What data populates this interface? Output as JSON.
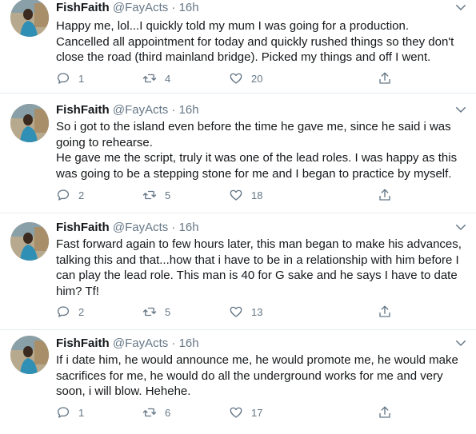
{
  "tweets": [
    {
      "name": "FishFaith",
      "handle": "@FayActs",
      "sep": "·",
      "time": "16h",
      "text": "Happy me, lol...I quickly told my mum I was going for a production.\nCancelled all appointment for today and quickly rushed things so they don't\nclose the road (third mainland bridge). Picked my things and off I went.",
      "replies": "1",
      "retweets": "4",
      "likes": "20"
    },
    {
      "name": "FishFaith",
      "handle": "@FayActs",
      "sep": "·",
      "time": "16h",
      "text": "So i got to the island even before the time he gave me, since he said i was\ngoing to rehearse.\nHe gave me the script, truly it was one of the lead roles. I was happy as this\nwas going to be a stepping stone for me and I began to practice by myself.",
      "replies": "2",
      "retweets": "5",
      "likes": "18"
    },
    {
      "name": "FishFaith",
      "handle": "@FayActs",
      "sep": "·",
      "time": "16h",
      "text": "Fast forward again to few hours later, this man began to make his advances,\ntalking this and that...how that i have to be in a relationship with him before I\ncan play the lead role. This man is 40 for G sake and he says I have to date\nhim? Tf!",
      "replies": "2",
      "retweets": "5",
      "likes": "13"
    },
    {
      "name": "FishFaith",
      "handle": "@FayActs",
      "sep": "·",
      "time": "16h",
      "text": "If i date him, he would announce me, he would promote me, he would make\nsacrifices for me, he would do all the underground works for me and very\nsoon, i will blow. Hehehe.",
      "replies": "1",
      "retweets": "6",
      "likes": "17"
    }
  ]
}
